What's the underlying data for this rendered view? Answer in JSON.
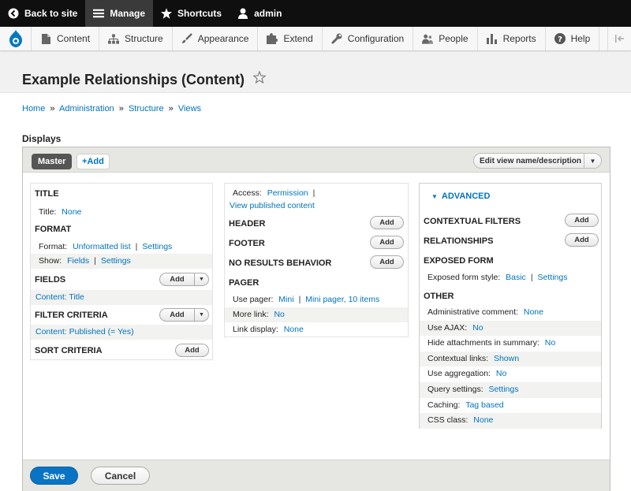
{
  "toolbar": {
    "back_to_site": "Back to site",
    "manage": "Manage",
    "shortcuts": "Shortcuts",
    "user": "admin"
  },
  "menu": {
    "items": [
      "Content",
      "Structure",
      "Appearance",
      "Extend",
      "Configuration",
      "People",
      "Reports",
      "Help"
    ]
  },
  "page": {
    "title": "Example Relationships (Content)",
    "breadcrumb": [
      "Home",
      "Administration",
      "Structure",
      "Views"
    ],
    "breadcrumb_sep": "»",
    "displays_label": "Displays"
  },
  "displays": {
    "master_tab": "Master",
    "add_tab": "Add",
    "edit_view": "Edit view name/description"
  },
  "col1": {
    "title_section": "TITLE",
    "title_key": "Title:",
    "title_value": "None",
    "format_section": "FORMAT",
    "format_key": "Format:",
    "format_value": "Unformatted list",
    "format_settings": "Settings",
    "show_key": "Show:",
    "show_value": "Fields",
    "show_settings": "Settings",
    "fields_section": "FIELDS",
    "fields_item": "Content: Title",
    "filter_section": "FILTER CRITERIA",
    "filter_item": "Content: Published (= Yes)",
    "sort_section": "SORT CRITERIA"
  },
  "col2": {
    "access_key": "Access:",
    "access_value": "Permission",
    "access_value2": "View published content",
    "header_section": "HEADER",
    "footer_section": "FOOTER",
    "noresults_section": "NO RESULTS BEHAVIOR",
    "pager_section": "PAGER",
    "use_pager_key": "Use pager:",
    "use_pager_value": "Mini",
    "use_pager_value2": "Mini pager, 10 items",
    "more_link_key": "More link:",
    "more_link_value": "No",
    "link_display_key": "Link display:",
    "link_display_value": "None"
  },
  "col3": {
    "advanced_toggle": "ADVANCED",
    "contextual_filters": "CONTEXTUAL FILTERS",
    "relationships": "RELATIONSHIPS",
    "exposed_form": "EXPOSED FORM",
    "exposed_style_key": "Exposed form style:",
    "exposed_style_value": "Basic",
    "exposed_style_settings": "Settings",
    "other": "OTHER",
    "rows": [
      {
        "k": "Administrative comment:",
        "v": "None"
      },
      {
        "k": "Use AJAX:",
        "v": "No"
      },
      {
        "k": "Hide attachments in summary:",
        "v": "No"
      },
      {
        "k": "Contextual links:",
        "v": "Shown"
      },
      {
        "k": "Use aggregation:",
        "v": "No"
      },
      {
        "k": "Query settings:",
        "v": "Settings"
      },
      {
        "k": "Caching:",
        "v": "Tag based"
      },
      {
        "k": "CSS class:",
        "v": "None"
      }
    ]
  },
  "buttons": {
    "add": "Add",
    "save": "Save",
    "cancel": "Cancel",
    "separator": "|"
  },
  "colors": {
    "link": "#0074bd",
    "primary_button": "#0a74c4",
    "toolbar_bg": "#0f0f0f"
  }
}
